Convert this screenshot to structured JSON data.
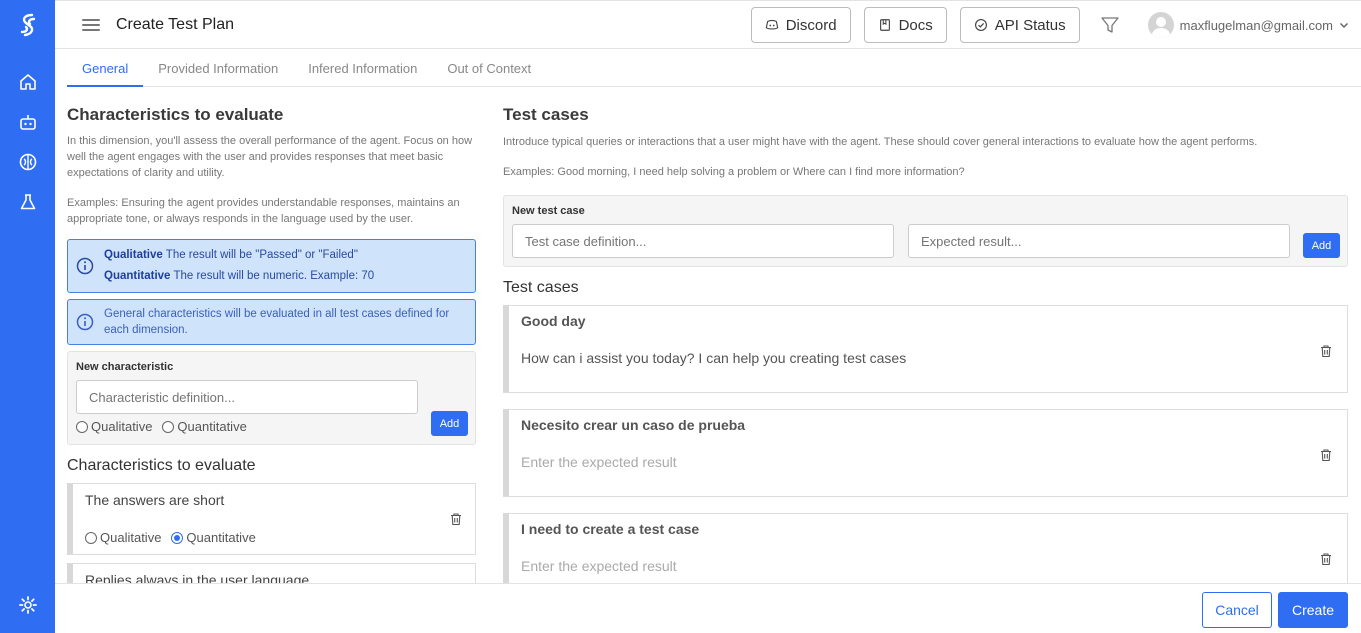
{
  "header": {
    "title": "Create Test Plan",
    "discord_label": "Discord",
    "docs_label": "Docs",
    "api_status_label": "API Status",
    "user_email": "maxflugelman@gmail.com"
  },
  "tabs": [
    {
      "label": "General"
    },
    {
      "label": "Provided Information"
    },
    {
      "label": "Infered Information"
    },
    {
      "label": "Out of Context"
    }
  ],
  "left": {
    "title": "Characteristics to evaluate",
    "description": "In this dimension, you'll assess the overall performance of the agent. Focus on how well the agent engages with the user and provides responses that meet basic expectations of clarity and utility.",
    "examples": "Examples: Ensuring the agent provides understandable responses, maintains an appropriate tone, or always responds in the language used by the user.",
    "info_qualitative_label": "Qualitative",
    "info_qualitative_text": " The result will be \"Passed\" or \"Failed\"",
    "info_quantitative_label": "Quantitative",
    "info_quantitative_text": " The result will be numeric. Example: 70",
    "info_general": "General characteristics will be evaluated in all test cases defined for each dimension.",
    "new_label": "New characteristic",
    "input_placeholder": "Characteristic definition...",
    "qualitative_option": "Qualitative",
    "quantitative_option": "Quantitative",
    "add_label": "Add",
    "list_title": "Characteristics to evaluate",
    "characteristics": [
      {
        "text": "The answers are short",
        "selected": "Quantitative"
      },
      {
        "text": "Replies always in the user language",
        "selected": ""
      }
    ]
  },
  "right": {
    "title": "Test cases",
    "description": "Introduce typical queries or interactions that a user might have with the agent. These should cover general interactions to evaluate how the agent performs.",
    "examples": "Examples: Good morning, I need help solving a problem or Where can I find more information?",
    "new_label": "New test case",
    "definition_placeholder": "Test case definition...",
    "expected_placeholder": "Expected result...",
    "add_label": "Add",
    "list_title": "Test cases",
    "test_cases": [
      {
        "title": "Good day",
        "expected": "How can i assist you today? I can help you creating test cases"
      },
      {
        "title": "Necesito crear un caso de prueba",
        "expected": "Enter the expected result"
      },
      {
        "title": "I need to create a test case",
        "expected": "Enter the expected result"
      }
    ]
  },
  "footer": {
    "cancel_label": "Cancel",
    "create_label": "Create"
  }
}
